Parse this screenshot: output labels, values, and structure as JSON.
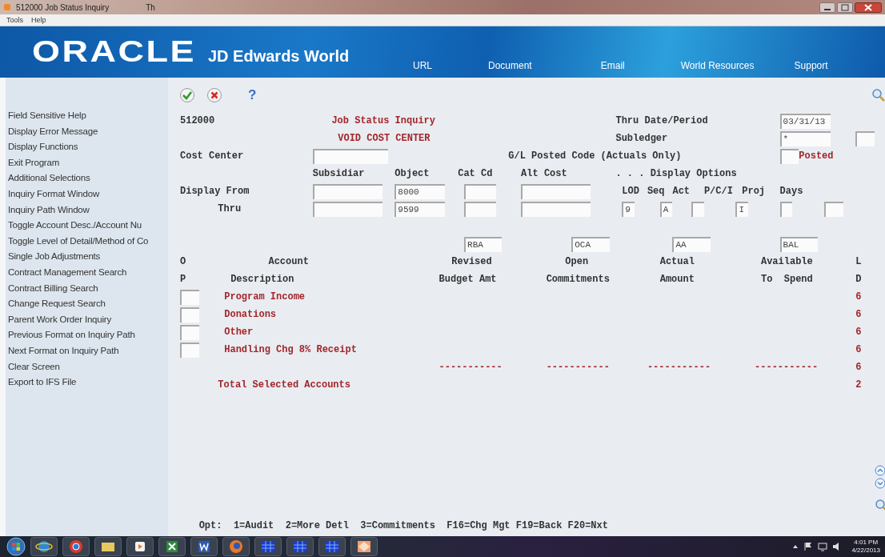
{
  "title_bar": {
    "title": "512000   Job Status Inquiry",
    "tab_hint": "Th"
  },
  "menu_bar": [
    "Tools",
    "Help"
  ],
  "banner": {
    "brand": "ORACLE",
    "product": "JD Edwards World",
    "links": [
      "URL",
      "Document",
      "Email",
      "World Resources",
      "Support"
    ]
  },
  "toolbar": {
    "help": "?"
  },
  "sidebar": {
    "items": [
      "Field Sensitive Help",
      "Display Error Message",
      "Display Functions",
      "Exit Program",
      "Additional Selections",
      "Inquiry Format Window",
      "Inquiry Path Window",
      "Toggle Account Desc./Account Nu",
      "Toggle Level of Detail/Method of Co",
      "Single Job Adjustments",
      "Contract Management Search",
      "Contract Billing Search",
      "Change Request Search",
      "Parent Work Order Inquiry",
      "Previous Format on Inquiry Path",
      "Next Format on Inquiry Path",
      "Clear Screen",
      "Export to IFS File"
    ]
  },
  "form": {
    "program_id": "512000",
    "title": "Job Status Inquiry",
    "subtitle": "VOID COST CENTER",
    "thru_date": {
      "label": "Thru Date/Period",
      "value": "03/31/13"
    },
    "subledger": {
      "label": "Subledger",
      "value": "*"
    },
    "cost_center": {
      "label": "Cost Center"
    },
    "gl_posted": {
      "label": "G/L Posted Code (Actuals Only)",
      "status": "Posted"
    },
    "range_columns": [
      {
        "header": "Subsidiar"
      },
      {
        "header": "Object",
        "from": "8000",
        "thru": "9599"
      },
      {
        "header": "Cat Cd"
      },
      {
        "header": "Alt Cost"
      }
    ],
    "display_from": {
      "label": "Display From"
    },
    "thru": {
      "label": "Thru"
    },
    "display_options": {
      "label": ". . . Display Options",
      "options": [
        {
          "label": "LOD",
          "value": "9"
        },
        {
          "label": "Seq",
          "value": "A"
        },
        {
          "label": "Act"
        },
        {
          "label": "P/C/I",
          "value": "I"
        },
        {
          "label": "Proj"
        },
        {
          "label": "Days"
        }
      ]
    },
    "op_header": [
      "O",
      "P"
    ],
    "account_header": [
      "Account",
      "Description"
    ],
    "ld_header": [
      "L",
      "D"
    ],
    "columns": [
      {
        "code": "RBA",
        "line1": "Revised",
        "line2": "Budget Amt"
      },
      {
        "code": "OCA",
        "line1": "Open",
        "line2": "Commitments"
      },
      {
        "code": "AA",
        "line1": "Actual",
        "line2": "Amount"
      },
      {
        "code": "BAL",
        "line1": "Available",
        "line2": "To  Spend"
      }
    ],
    "rows": [
      {
        "description": "Program Income",
        "ld": "6"
      },
      {
        "description": "Donations",
        "ld": "6"
      },
      {
        "description": "Other",
        "ld": "6"
      },
      {
        "description": "Handling Chg 8% Receipt",
        "ld": "6"
      }
    ],
    "totals": {
      "dashes": [
        "-----------",
        "-----------",
        "-----------",
        "-----------"
      ],
      "dashes_ld": "6",
      "label": "Total Selected Accounts",
      "ld": "2"
    },
    "footer": "Opt:  1=Audit  2=More Detl  3=Commitments  F16=Chg Mgt F19=Back F20=Nxt"
  },
  "clock": {
    "time": "4:01 PM",
    "date": "4/22/2013"
  }
}
